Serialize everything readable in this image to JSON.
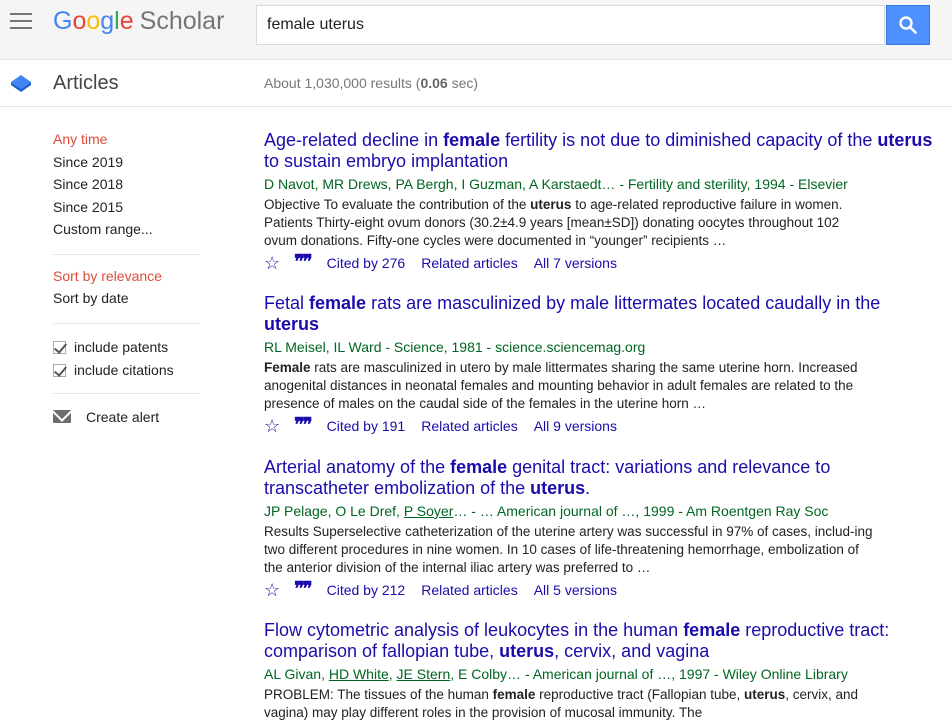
{
  "app": {
    "logo_parts": [
      "G",
      "o",
      "o",
      "g",
      "l",
      "e"
    ],
    "logo_suffix": "Scholar"
  },
  "search": {
    "value": "female uterus"
  },
  "subbar": {
    "section_label": "Articles",
    "results_prefix": "About 1,030,000 results (",
    "results_time": "0.06",
    "results_suffix": " sec)"
  },
  "sidebar": {
    "time_filters": [
      "Any time",
      "Since 2019",
      "Since 2018",
      "Since 2015",
      "Custom range..."
    ],
    "sort_options": [
      "Sort by relevance",
      "Sort by date"
    ],
    "include_patents": "include patents",
    "include_citations": "include citations",
    "create_alert": "Create alert"
  },
  "results": [
    {
      "title": [
        {
          "t": "Age-related decline in ",
          "b": false
        },
        {
          "t": "female",
          "b": true
        },
        {
          "t": " fertility is not due to diminished capacity of the ",
          "b": false
        },
        {
          "t": "uterus",
          "b": true
        },
        {
          "t": " to sustain embryo implantation",
          "b": false
        }
      ],
      "meta": [
        {
          "t": "D Navot, MR Drews, PA Bergh, I Guzman, A Karstaedt… - Fertility and sterility, 1994 - Elsevier",
          "u": false
        }
      ],
      "snippet": [
        {
          "t": "Objective To evaluate the contribution of the ",
          "b": false
        },
        {
          "t": "uterus",
          "b": true
        },
        {
          "t": " to age-related reproductive failure in women. Patients Thirty-eight ovum donors (30.2±4.9 years [mean±SD]) donating oocytes throughout 102 ovum donations. Fifty-one cycles were documented in “younger” recipients …",
          "b": false
        }
      ],
      "cited_by": "Cited by 276",
      "related": "Related articles",
      "versions": "All 7 versions"
    },
    {
      "title": [
        {
          "t": "Fetal ",
          "b": false
        },
        {
          "t": "female",
          "b": true
        },
        {
          "t": " rats are masculinized by male littermates located caudally in the ",
          "b": false
        },
        {
          "t": "uterus",
          "b": true
        }
      ],
      "meta": [
        {
          "t": "RL Meisel, IL Ward - Science, 1981 - science.sciencemag.org",
          "u": false
        }
      ],
      "snippet": [
        {
          "t": "Female",
          "b": true
        },
        {
          "t": " rats are masculinized in utero by male littermates sharing the same uterine horn. Increased anogenital distances in neonatal females and mounting behavior in adult females are related to the presence of males on the caudal side of the females in the uterine horn …",
          "b": false
        }
      ],
      "cited_by": "Cited by 191",
      "related": "Related articles",
      "versions": "All 9 versions"
    },
    {
      "title": [
        {
          "t": "Arterial anatomy of the ",
          "b": false
        },
        {
          "t": "female",
          "b": true
        },
        {
          "t": " genital tract: variations and relevance to transcatheter embolization of the ",
          "b": false
        },
        {
          "t": "uterus",
          "b": true
        },
        {
          "t": ".",
          "b": false
        }
      ],
      "meta": [
        {
          "t": "JP Pelage, O Le Dref, ",
          "u": false
        },
        {
          "t": "P Soyer",
          "u": true
        },
        {
          "t": "… - … American journal of …, 1999 - Am Roentgen Ray Soc",
          "u": false
        }
      ],
      "snippet": [
        {
          "t": "Results Superselective catheterization of the uterine artery was successful in 97% of cases, includ-ing two different procedures in nine women. In 10 cases of life-threatening hemorrhage, embolization of the anterior division of the internal iliac artery was preferred to …",
          "b": false
        }
      ],
      "cited_by": "Cited by 212",
      "related": "Related articles",
      "versions": "All 5 versions"
    },
    {
      "title": [
        {
          "t": "Flow cytometric analysis of leukocytes in the human ",
          "b": false
        },
        {
          "t": "female",
          "b": true
        },
        {
          "t": " reproductive tract: comparison of fallopian tube, ",
          "b": false
        },
        {
          "t": "uterus",
          "b": true
        },
        {
          "t": ", cervix, and vagina",
          "b": false
        }
      ],
      "meta": [
        {
          "t": "AL Givan, ",
          "u": false
        },
        {
          "t": "HD White",
          "u": true
        },
        {
          "t": ", ",
          "u": false
        },
        {
          "t": "JE Stern",
          "u": true
        },
        {
          "t": ", E Colby… - American journal of …, 1997 - Wiley Online Library",
          "u": false
        }
      ],
      "snippet": [
        {
          "t": "PROBLEM: The tissues of the human ",
          "b": false
        },
        {
          "t": "female",
          "b": true
        },
        {
          "t": " reproductive tract (Fallopian tube, ",
          "b": false
        },
        {
          "t": "uterus",
          "b": true
        },
        {
          "t": ", cervix, and vagina) may play different roles in the provision of mucosal immunity. The",
          "b": false
        }
      ],
      "cited_by": "",
      "related": "",
      "versions": ""
    }
  ],
  "colors": {
    "link": "#1a0dab",
    "meta_green": "#006621",
    "active_red": "#dd4b39",
    "search_blue": "#4d90fe"
  }
}
